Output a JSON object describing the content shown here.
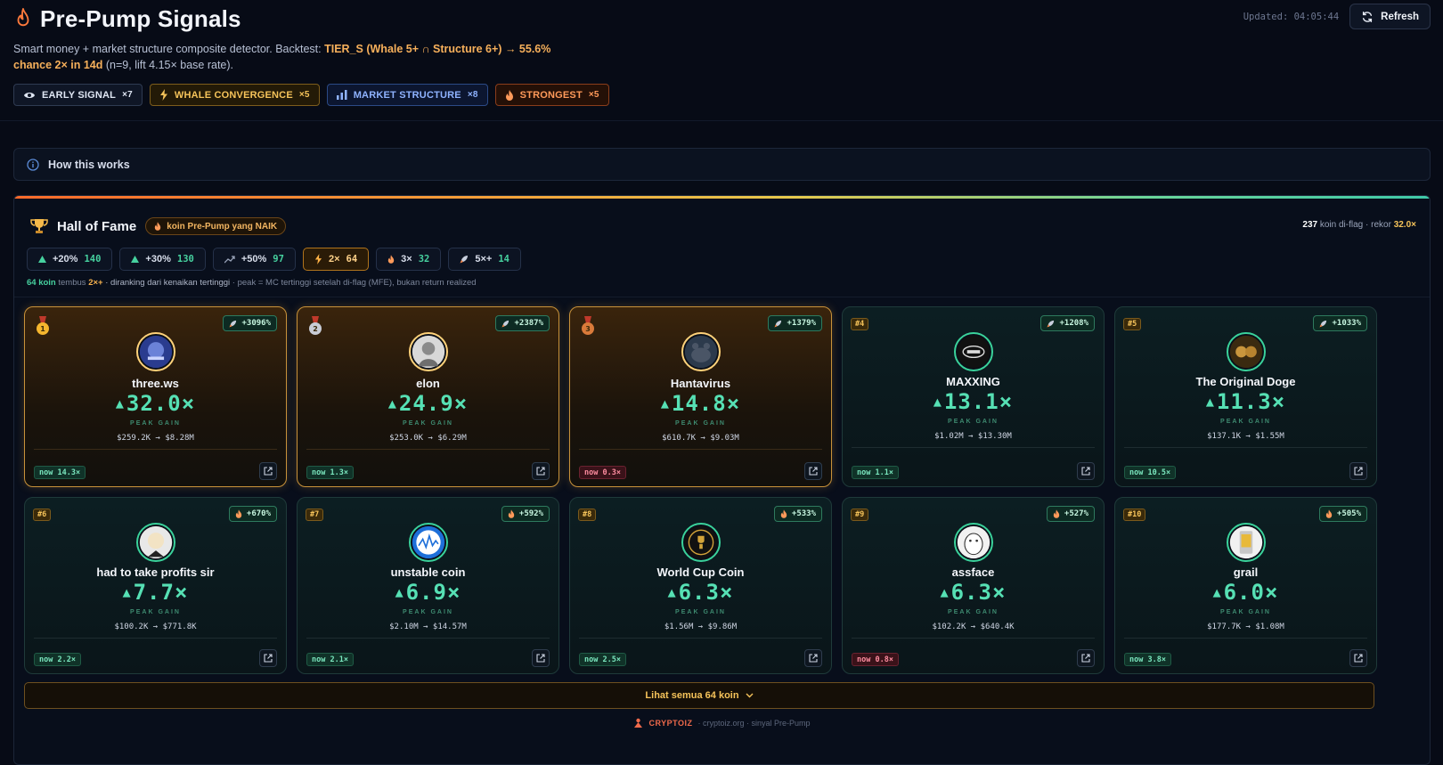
{
  "header": {
    "title": "Pre-Pump Signals",
    "subtitle_lead": "Smart money + market structure composite detector. Backtest: ",
    "subtitle_highlight": "TIER_S (Whale 5+ ∩ Structure 6+) → 55.6% chance 2× in 14d",
    "subtitle_tail": " (n=9, lift 4.15× base rate).",
    "updated": "Updated: 04:05:44",
    "refresh_label": "Refresh",
    "chips": [
      {
        "label": "EARLY SIGNAL",
        "count": "×7"
      },
      {
        "label": "WHALE CONVERGENCE",
        "count": "×5"
      },
      {
        "label": "MARKET STRUCTURE",
        "count": "×8"
      },
      {
        "label": "STRONGEST",
        "count": "×5"
      }
    ]
  },
  "how": {
    "label": "How this works"
  },
  "hof": {
    "title": "Hall of Fame",
    "badge": "koin Pre-Pump yang NAIK",
    "stat_count": "237",
    "stat_mid": " koin di-flag · rekor ",
    "stat_record": "32.0×",
    "filters": [
      {
        "label": "+20%",
        "count": "140"
      },
      {
        "label": "+30%",
        "count": "130"
      },
      {
        "label": "+50%",
        "count": "97"
      },
      {
        "label": "2×",
        "count": "64"
      },
      {
        "label": "3×",
        "count": "32"
      },
      {
        "label": "5×+",
        "count": "14"
      }
    ],
    "note_count": "64 koin",
    "note_mid": " tembus ",
    "note_mult": "2×+",
    "note_rank": " · diranking dari kenaikan tertinggi",
    "note_tail": " · peak = MC tertinggi setelah di-flag (MFE), bukan return realized",
    "see_all": "Lihat semua 64 koin",
    "footer_brand": "CRYPTOIZ",
    "footer_text": "· cryptoiz.org · sinyal Pre-Pump"
  },
  "cards": [
    {
      "rank": "1",
      "name": "three.ws",
      "gain": "+3096%",
      "peak": "32.0×",
      "peak_label": "PEAK GAIN",
      "mc": "$259.2K → $8.28M",
      "now": "now 14.3×",
      "down": false
    },
    {
      "rank": "2",
      "name": "elon",
      "gain": "+2387%",
      "peak": "24.9×",
      "peak_label": "PEAK GAIN",
      "mc": "$253.0K → $6.29M",
      "now": "now 1.3×",
      "down": false
    },
    {
      "rank": "3",
      "name": "Hantavirus",
      "gain": "+1379%",
      "peak": "14.8×",
      "peak_label": "PEAK GAIN",
      "mc": "$610.7K → $9.03M",
      "now": "now 0.3×",
      "down": true
    },
    {
      "rank": "#4",
      "name": "MAXXING",
      "gain": "+1208%",
      "peak": "13.1×",
      "peak_label": "PEAK GAIN",
      "mc": "$1.02M → $13.30M",
      "now": "now 1.1×",
      "down": false
    },
    {
      "rank": "#5",
      "name": "The Original Doge",
      "gain": "+1033%",
      "peak": "11.3×",
      "peak_label": "PEAK GAIN",
      "mc": "$137.1K → $1.55M",
      "now": "now 10.5×",
      "down": false
    },
    {
      "rank": "#6",
      "name": "had to take profits sir",
      "gain": "+670%",
      "peak": "7.7×",
      "peak_label": "PEAK GAIN",
      "mc": "$100.2K → $771.8K",
      "now": "now 2.2×",
      "down": false
    },
    {
      "rank": "#7",
      "name": "unstable coin",
      "gain": "+592%",
      "peak": "6.9×",
      "peak_label": "PEAK GAIN",
      "mc": "$2.10M → $14.57M",
      "now": "now 2.1×",
      "down": false
    },
    {
      "rank": "#8",
      "name": "World Cup Coin",
      "gain": "+533%",
      "peak": "6.3×",
      "peak_label": "PEAK GAIN",
      "mc": "$1.56M → $9.86M",
      "now": "now 2.5×",
      "down": false
    },
    {
      "rank": "#9",
      "name": "assface",
      "gain": "+527%",
      "peak": "6.3×",
      "peak_label": "PEAK GAIN",
      "mc": "$102.2K → $640.4K",
      "now": "now 0.8×",
      "down": true
    },
    {
      "rank": "#10",
      "name": "grail",
      "gain": "+505%",
      "peak": "6.0×",
      "peak_label": "PEAK GAIN",
      "mc": "$177.7K → $1.08M",
      "now": "now 3.8×",
      "down": false
    }
  ],
  "colors": {
    "accent": "#56e0b4",
    "gold": "#f5c35a",
    "orange": "#f7b05b",
    "bg": "#070b16"
  }
}
